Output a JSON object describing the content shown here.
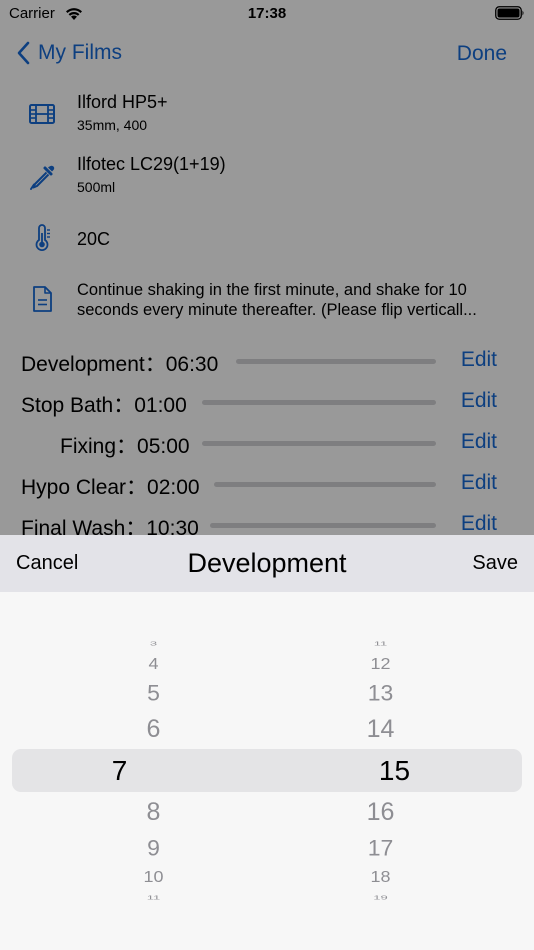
{
  "status": {
    "carrier": "Carrier",
    "time": "17:38"
  },
  "nav": {
    "back_label": "My Films",
    "done_label": "Done"
  },
  "film": {
    "name": "Ilford HP5+",
    "details": "35mm, 400"
  },
  "developer": {
    "name": "Ilfotec LC29(1+19)",
    "volume": "500ml"
  },
  "temperature": {
    "value": "20C"
  },
  "note": {
    "text": "Continue shaking in the first minute, and shake for 10 seconds every minute thereafter. (Please flip verticall..."
  },
  "steps": [
    {
      "label": "Development：06:30",
      "edit": "Edit"
    },
    {
      "label": "Stop Bath：01:00",
      "edit": "Edit"
    },
    {
      "label": "Fixing：05:00",
      "edit": "Edit"
    },
    {
      "label": "Hypo Clear：02:00",
      "edit": "Edit"
    },
    {
      "label": "Final Wash：10:30",
      "edit": "Edit"
    }
  ],
  "sheet": {
    "cancel_label": "Cancel",
    "title": "Development",
    "save_label": "Save"
  },
  "picker": {
    "minutes": [
      "3",
      "4",
      "5",
      "6",
      "7",
      "8",
      "9",
      "10",
      "11"
    ],
    "seconds": [
      "11",
      "12",
      "13",
      "14",
      "15",
      "16",
      "17",
      "18",
      "19"
    ],
    "selected_minutes": "7",
    "selected_seconds": "15"
  },
  "colors": {
    "accent": "#1769d6",
    "sheet_header": "#e3e3e8",
    "picker_bg": "#f7f7f7"
  }
}
